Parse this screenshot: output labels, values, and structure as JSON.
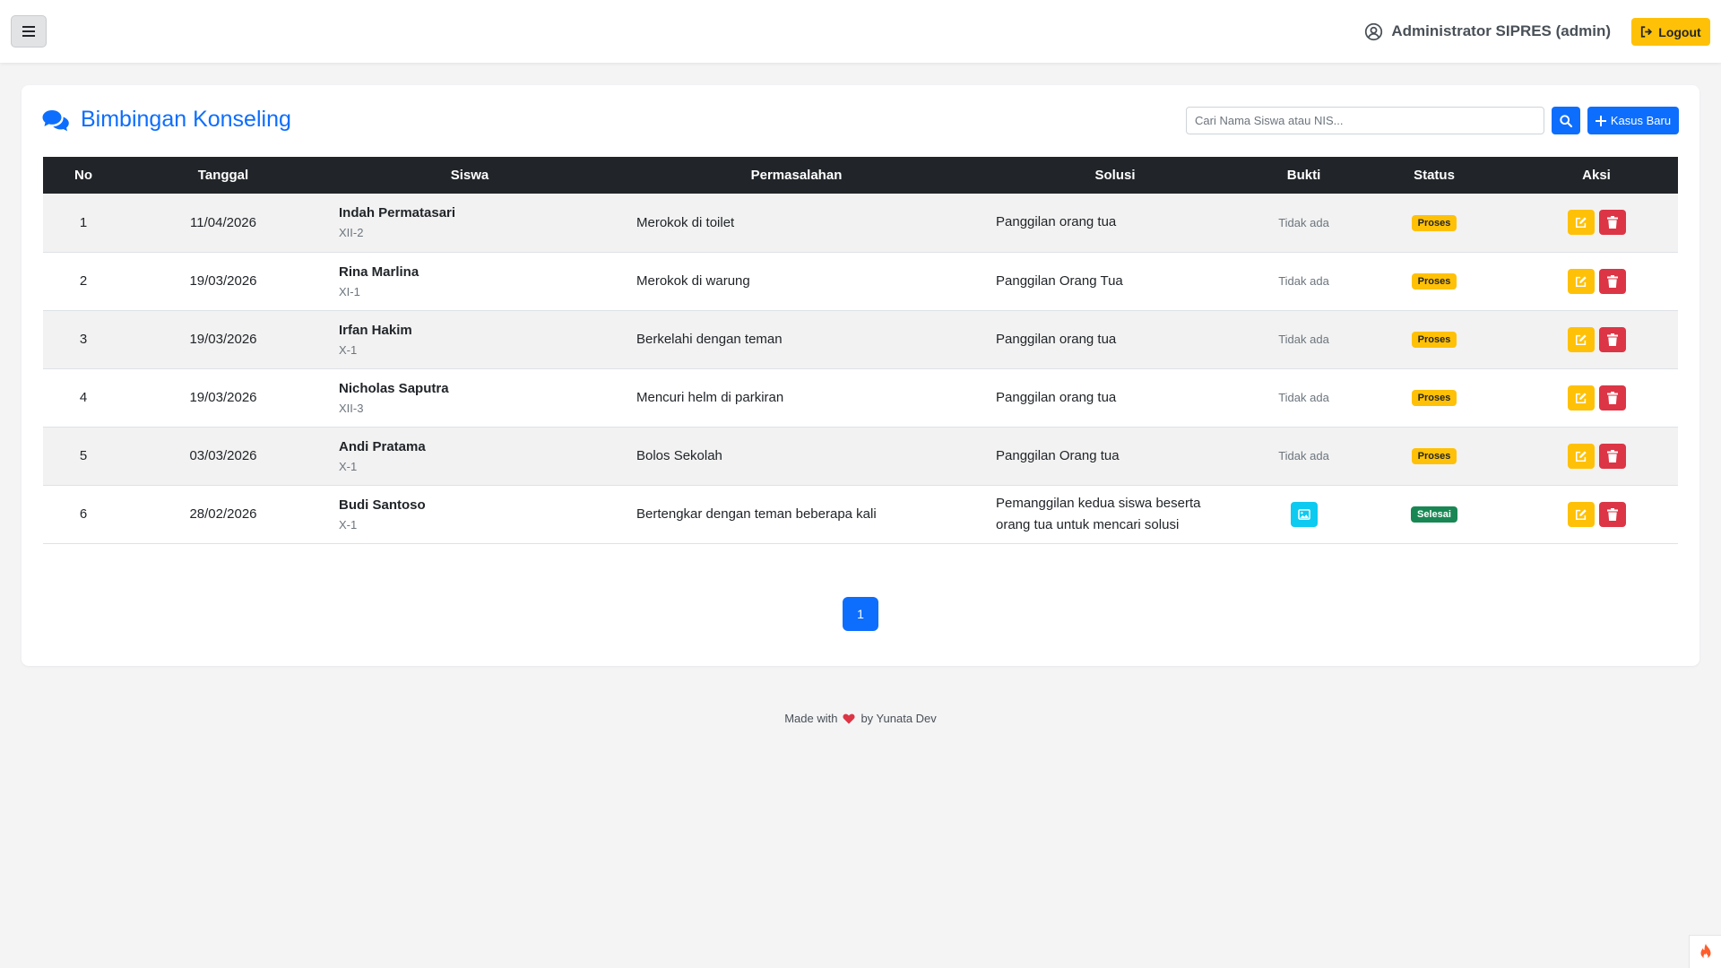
{
  "navbar": {
    "menu_icon": "hamburger-icon",
    "user_icon": "user-circle-icon",
    "user_label": "Administrator SIPRES (admin)",
    "logout_icon": "sign-out-icon",
    "logout_label": "Logout"
  },
  "page": {
    "title_icon": "comments-icon",
    "title": "Bimbingan Konseling",
    "search_placeholder": "Cari Nama Siswa atau NIS...",
    "search_icon": "search-icon",
    "new_case_icon": "plus-icon",
    "new_case_label": "Kasus Baru"
  },
  "table": {
    "headers": {
      "no": "No",
      "date": "Tanggal",
      "student": "Siswa",
      "problem": "Permasalahan",
      "solution": "Solusi",
      "evidence": "Bukti",
      "status": "Status",
      "action": "Aksi"
    },
    "rows": [
      {
        "no": "1",
        "date": "11/04/2026",
        "name": "Indah Permatasari",
        "class": "XII-2",
        "problem": "Merokok di toilet",
        "solution": "Panggilan orang tua",
        "evidence": "Tidak ada",
        "status": "Proses"
      },
      {
        "no": "2",
        "date": "19/03/2026",
        "name": "Rina Marlina",
        "class": "XI-1",
        "problem": "Merokok di warung",
        "solution": "Panggilan Orang Tua",
        "evidence": "Tidak ada",
        "status": "Proses"
      },
      {
        "no": "3",
        "date": "19/03/2026",
        "name": "Irfan Hakim",
        "class": "X-1",
        "problem": "Berkelahi dengan teman",
        "solution": "Panggilan orang tua",
        "evidence": "Tidak ada",
        "status": "Proses"
      },
      {
        "no": "4",
        "date": "19/03/2026",
        "name": "Nicholas Saputra",
        "class": "XII-3",
        "problem": "Mencuri helm di parkiran",
        "solution": "Panggilan orang tua",
        "evidence": "Tidak ada",
        "status": "Proses"
      },
      {
        "no": "5",
        "date": "03/03/2026",
        "name": "Andi Pratama",
        "class": "X-1",
        "problem": "Bolos Sekolah",
        "solution": "Panggilan Orang tua",
        "evidence": "Tidak ada",
        "status": "Proses"
      },
      {
        "no": "6",
        "date": "28/02/2026",
        "name": "Budi Santoso",
        "class": "X-1",
        "problem": "Bertengkar dengan teman beberapa kali",
        "solution": "Pemanggilan kedua siswa beserta orang tua untuk mencari solusi",
        "evidence": "image",
        "status": "Selesai"
      }
    ],
    "edit_icon": "edit-icon",
    "delete_icon": "trash-icon",
    "evidence_icon": "image-icon"
  },
  "pagination": {
    "current": "1"
  },
  "footer": {
    "made_with": "Made with",
    "heart_icon": "heart-icon",
    "by": "by Yunata Dev"
  },
  "corner": {
    "icon": "flame-icon"
  },
  "colors": {
    "primary": "#0d6efd",
    "warning": "#ffc107",
    "danger": "#dc3545",
    "success": "#198754",
    "info": "#0dcaf0",
    "dark": "#212529"
  }
}
